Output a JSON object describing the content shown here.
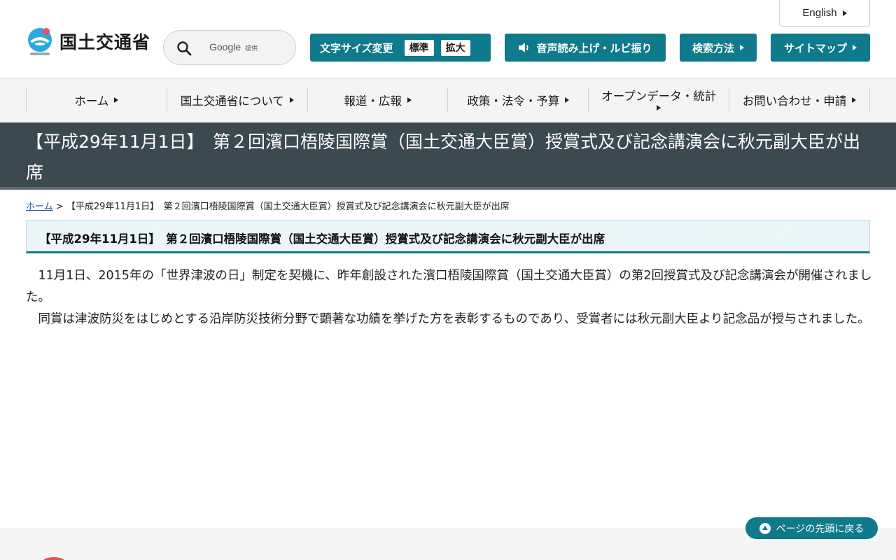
{
  "header": {
    "logo_text": "国土交通省",
    "search": {
      "provider": "Google",
      "provider_suffix": "提供"
    },
    "fontsize": {
      "label": "文字サイズ変更",
      "standard": "標準",
      "large": "拡大"
    },
    "voice_label": "音声読み上げ・ルビ振り",
    "search_method_label": "検索方法",
    "sitemap_label": "サイトマップ",
    "english_label": "English"
  },
  "nav": {
    "items": [
      {
        "label": "ホーム"
      },
      {
        "label": "国土交通省について"
      },
      {
        "label": "報道・広報"
      },
      {
        "label": "政策・法令・予算"
      },
      {
        "label": "オープンデータ・統計"
      },
      {
        "label": "お問い合わせ・申請"
      }
    ]
  },
  "page": {
    "title": "【平成29年11月1日】　第２回濱口梧陵国際賞（国土交通大臣賞）授賞式及び記念講演会に秋元副大臣が出席",
    "breadcrumb": {
      "home": "ホーム",
      "separator": ">",
      "current": "【平成29年11月1日】　第２回濱口梧陵国際賞（国土交通大臣賞）授賞式及び記念講演会に秋元副大臣が出席"
    },
    "heading": "【平成29年11月1日】　第２回濱口梧陵国際賞（国土交通大臣賞）授賞式及び記念講演会に秋元副大臣が出席",
    "paragraphs": [
      "11月1日、2015年の「世界津波の日」制定を契機に、昨年創設された濱口梧陵国際賞（国土交通大臣賞）の第2回授賞式及び記念講演会が開催されました。",
      "同賞は津波防災をはじめとする沿岸防災技術分野で顕著な功績を挙げた方を表彰するものであり、受賞者には秋元副大臣より記念品が授与されました。"
    ]
  },
  "pagetop_label": "ページの先頭に戻る",
  "colors": {
    "accent": "#0f7a8c",
    "title_band": "#3a4a50"
  }
}
